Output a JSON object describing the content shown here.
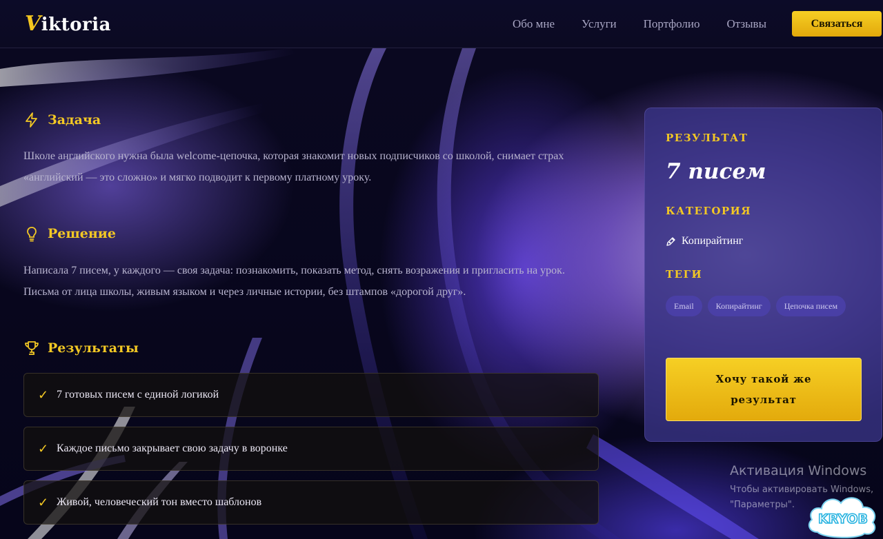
{
  "header": {
    "logo_initial": "V",
    "logo_rest": "iktoria",
    "nav": [
      "Обо мне",
      "Услуги",
      "Портфолио",
      "Отзывы"
    ],
    "cta_label": "Связаться"
  },
  "task": {
    "title": "Задача",
    "icon": "lightning-icon",
    "text": "Школе английского нужна была welcome-цепочка, которая знакомит новых подписчиков со школой, снимает страх «английский — это сложно» и мягко подводит к первому платному уроку."
  },
  "solution": {
    "title": "Решение",
    "icon": "lightbulb-icon",
    "text": "Написала 7 писем, у каждого — своя задача: познакомить, показать метод, снять возражения и пригласить на урок. Письма от лица школы, живым языком и через личные истории, без штампов «дорогой друг»."
  },
  "results": {
    "title": "Результаты",
    "icon": "trophy-icon",
    "check": "✓",
    "items": [
      "7 готовых писем с единой логикой",
      "Каждое письмо закрывает свою задачу в воронке",
      "Живой, человеческий тон вместо шаблонов"
    ]
  },
  "card": {
    "result_label": "РЕЗУЛЬТАТ",
    "result_value": "7 писем",
    "category_label": "КАТЕГОРИЯ",
    "category_value": "Копирайтинг",
    "tags_label": "ТЕГИ",
    "tags": [
      "Email",
      "Копирайтинг",
      "Цепочка писем"
    ],
    "button_label": "Хочу такой же результат"
  },
  "watermark": {
    "title": "Активация Windows",
    "line1": "Чтобы активировать Windows,",
    "line2": "\"Параметры\"."
  },
  "badge_text": "KRYOB",
  "colors": {
    "accent": "#f3c824",
    "background": "#07061a",
    "card": "#37328a"
  }
}
